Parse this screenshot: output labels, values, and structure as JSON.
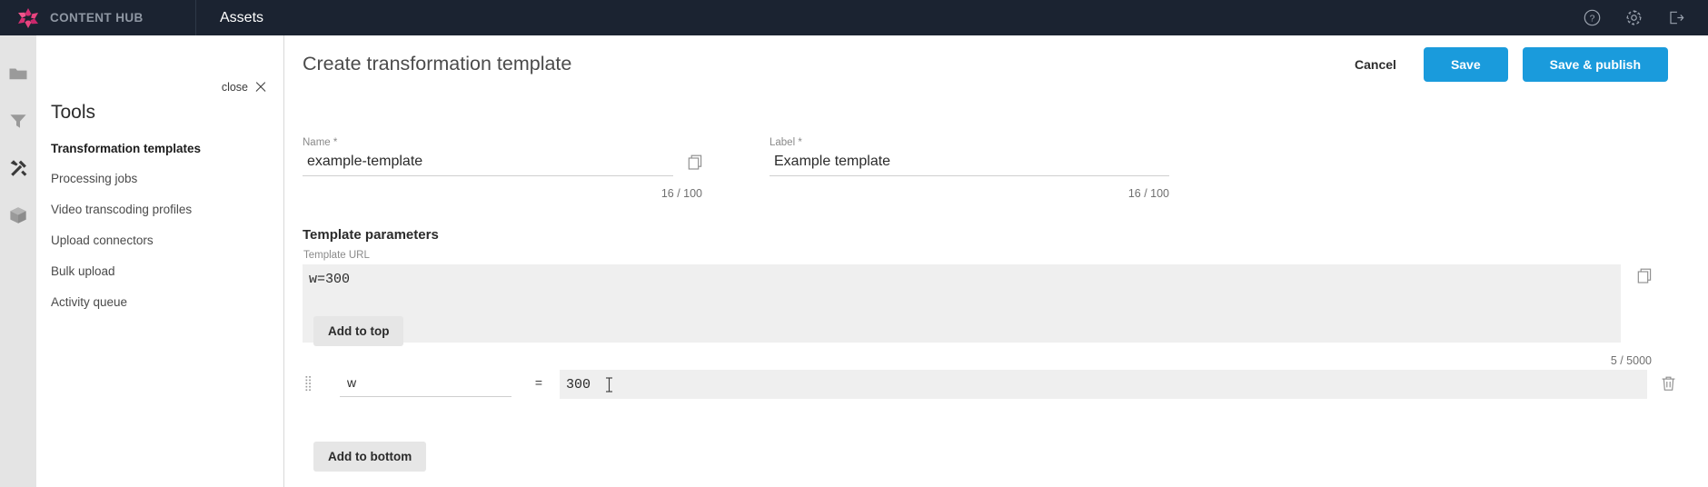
{
  "topbar": {
    "brand_name": "CONTENT HUB",
    "app_title": "Assets",
    "icons": [
      {
        "name": "help-icon",
        "glyph": "?"
      },
      {
        "name": "settings-gear-icon",
        "glyph": "gear"
      },
      {
        "name": "logout-icon",
        "glyph": "exit"
      }
    ]
  },
  "rail": {
    "items": [
      {
        "name": "folder-icon",
        "label": "Folders"
      },
      {
        "name": "filter-icon",
        "label": "Filters"
      },
      {
        "name": "tools-icon",
        "label": "Tools",
        "active": true
      },
      {
        "name": "package-icon",
        "label": "Packages"
      }
    ]
  },
  "tools_panel": {
    "close_label": "close",
    "title": "Tools",
    "items": [
      {
        "label": "Transformation templates",
        "active": true
      },
      {
        "label": "Processing jobs",
        "active": false
      },
      {
        "label": "Video transcoding profiles",
        "active": false
      },
      {
        "label": "Upload connectors",
        "active": false
      },
      {
        "label": "Bulk upload",
        "active": false
      },
      {
        "label": "Activity queue",
        "active": false
      }
    ]
  },
  "page": {
    "title": "Create transformation template",
    "cancel_label": "Cancel",
    "save_label": "Save",
    "save_publish_label": "Save & publish",
    "accent_color": "#1a9bdc"
  },
  "form": {
    "name_field": {
      "label": "Name *",
      "value": "example-template",
      "placeholder": "",
      "counter": "16 / 100"
    },
    "label_field": {
      "label": "Label *",
      "value": "Example template",
      "placeholder": "",
      "counter": "16 / 100"
    },
    "section_title": "Template parameters",
    "template_url": {
      "label": "Template URL",
      "value": "w=300",
      "placeholder": "",
      "counter": "5 / 5000"
    },
    "add_to_top_label": "Add to top",
    "add_to_bottom_label": "Add to bottom",
    "parameters": [
      {
        "key": "w",
        "key_placeholder": "",
        "equals": "=",
        "value": "300",
        "value_placeholder": ""
      }
    ]
  }
}
